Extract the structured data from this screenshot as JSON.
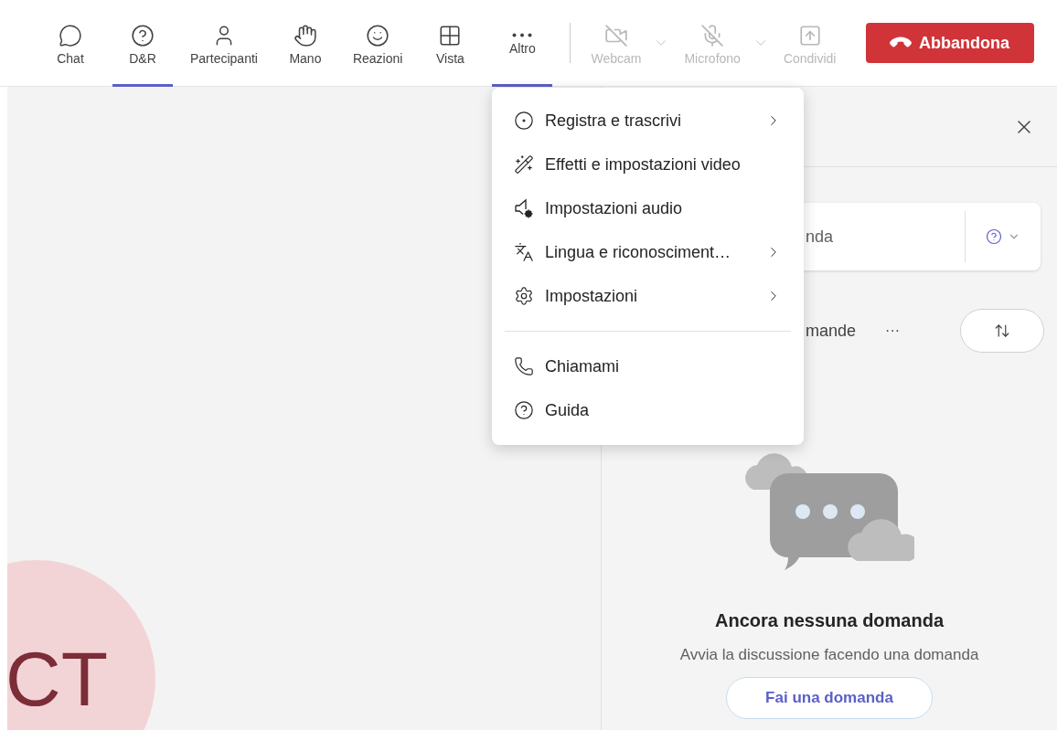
{
  "toolbar": {
    "items": [
      {
        "label": "Chat",
        "selected": false,
        "disabled": false
      },
      {
        "label": "D&R",
        "selected": true,
        "disabled": false
      },
      {
        "label": "Partecipanti",
        "selected": false,
        "disabled": false
      },
      {
        "label": "Mano",
        "selected": false,
        "disabled": false
      },
      {
        "label": "Reazioni",
        "selected": false,
        "disabled": false
      },
      {
        "label": "Vista",
        "selected": false,
        "disabled": false
      },
      {
        "label": "Altro",
        "selected": true,
        "disabled": false
      }
    ],
    "devices": [
      {
        "label": "Webcam",
        "selected": false,
        "disabled": true,
        "caret": true
      },
      {
        "label": "Microfono",
        "selected": false,
        "disabled": true,
        "caret": true
      },
      {
        "label": "Condividi",
        "selected": false,
        "disabled": true,
        "caret": false
      }
    ],
    "leave_button": "Abbandona"
  },
  "stage": {
    "avatar_initials": "CT"
  },
  "panel": {
    "compose_placeholder": "nda",
    "sort_label": "mande",
    "more": "···",
    "empty_title": "Ancora nessuna domanda",
    "empty_text": "Avvia la discussione facendo una domanda",
    "ask_button": "Fai una domanda"
  },
  "menu": {
    "groups": [
      [
        {
          "label": "Registra e trascrivi",
          "submenu": true
        },
        {
          "label": "Effetti e impostazioni video",
          "submenu": false
        },
        {
          "label": "Impostazioni audio",
          "submenu": false
        },
        {
          "label": "Lingua e riconosciment…",
          "submenu": true
        },
        {
          "label": "Impostazioni",
          "submenu": true
        }
      ],
      [
        {
          "label": "Chiamami",
          "submenu": false
        },
        {
          "label": "Guida",
          "submenu": false
        }
      ]
    ]
  }
}
